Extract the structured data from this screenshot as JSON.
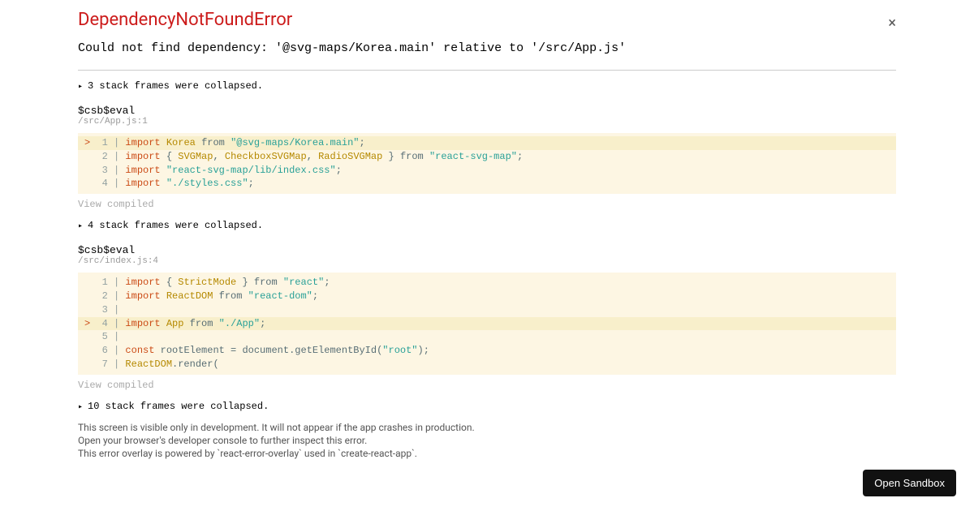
{
  "title": "DependencyNotFoundError",
  "message": "Could not find dependency: '@svg-maps/Korea.main' relative to '/src/App.js'",
  "frames": [
    {
      "collapsed": "3 stack frames were collapsed.",
      "name": "$csb$eval",
      "location": "/src/App.js:1",
      "lines": [
        {
          "n": "1",
          "highlighted": true,
          "pointer": ">",
          "html": "<span class='tok-import'>import</span> <span class='tok-ident'>Korea</span> <span class='tok-plain'>from</span> <span class='tok-string'>\"@svg-maps/Korea.main\"</span><span class='tok-plain'>;</span>"
        },
        {
          "n": "2",
          "highlighted": false,
          "pointer": " ",
          "html": "<span class='tok-import'>import</span> <span class='tok-plain'>{</span> <span class='tok-ident'>SVGMap</span><span class='tok-plain'>,</span> <span class='tok-ident'>CheckboxSVGMap</span><span class='tok-plain'>,</span> <span class='tok-ident'>RadioSVGMap</span> <span class='tok-plain'>}</span> <span class='tok-plain'>from</span> <span class='tok-string'>\"react-svg-map\"</span><span class='tok-plain'>;</span>"
        },
        {
          "n": "3",
          "highlighted": false,
          "pointer": " ",
          "html": "<span class='tok-import'>import</span> <span class='tok-string'>\"react-svg-map/lib/index.css\"</span><span class='tok-plain'>;</span>"
        },
        {
          "n": "4",
          "highlighted": false,
          "pointer": " ",
          "html": "<span class='tok-import'>import</span> <span class='tok-string'>\"./styles.css\"</span><span class='tok-plain'>;</span>"
        }
      ],
      "viewCompiled": "View compiled"
    },
    {
      "collapsed": "4 stack frames were collapsed.",
      "name": "$csb$eval",
      "location": "/src/index.js:4",
      "lines": [
        {
          "n": "1",
          "highlighted": false,
          "pointer": " ",
          "html": "<span class='tok-import'>import</span> <span class='tok-plain'>{</span> <span class='tok-ident'>StrictMode</span> <span class='tok-plain'>}</span> <span class='tok-plain'>from</span> <span class='tok-string'>\"react\"</span><span class='tok-plain'>;</span>"
        },
        {
          "n": "2",
          "highlighted": false,
          "pointer": " ",
          "html": "<span class='tok-import'>import</span> <span class='tok-ident'>ReactDOM</span> <span class='tok-plain'>from</span> <span class='tok-string'>\"react-dom\"</span><span class='tok-plain'>;</span>"
        },
        {
          "n": "3",
          "highlighted": false,
          "pointer": " ",
          "html": ""
        },
        {
          "n": "4",
          "highlighted": true,
          "pointer": ">",
          "html": "<span class='tok-import'>import</span> <span class='tok-ident'>App</span> <span class='tok-plain'>from</span> <span class='tok-string'>\"./App\"</span><span class='tok-plain'>;</span>"
        },
        {
          "n": "5",
          "highlighted": false,
          "pointer": " ",
          "html": ""
        },
        {
          "n": "6",
          "highlighted": false,
          "pointer": " ",
          "html": "<span class='tok-const'>const</span> <span class='tok-plain'>rootElement = document.getElementById(</span><span class='tok-string'>\"root\"</span><span class='tok-plain'>);</span>"
        },
        {
          "n": "7",
          "highlighted": false,
          "pointer": " ",
          "html": "<span class='tok-ident'>ReactDOM</span><span class='tok-plain'>.render(</span>"
        }
      ],
      "viewCompiled": "View compiled"
    }
  ],
  "finalCollapsed": "10 stack frames were collapsed.",
  "footer": {
    "line1": "This screen is visible only in development. It will not appear if the app crashes in production.",
    "line2": "Open your browser's developer console to further inspect this error.",
    "line3": "This error overlay is powered by `react-error-overlay` used in `create-react-app`."
  },
  "sandboxButton": "Open Sandbox",
  "closeGlyph": "×"
}
